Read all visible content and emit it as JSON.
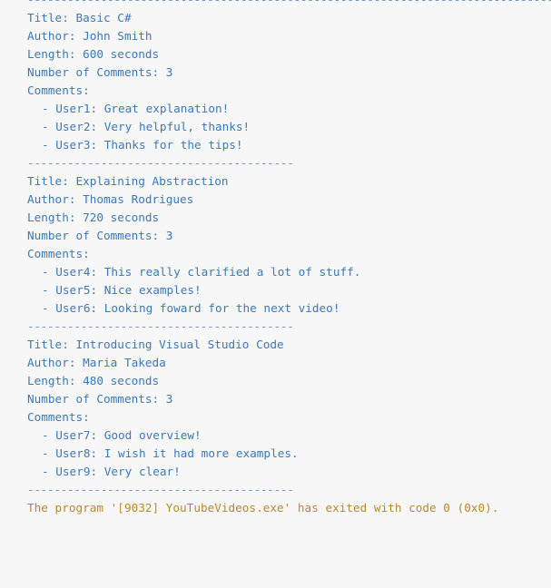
{
  "output": {
    "top_separator": "--------------------------------------------------------------------------------------",
    "videos": [
      {
        "title_line": "Title: Basic C#",
        "author_line": "Author: John Smith",
        "length_line": "Length: 600 seconds",
        "count_line": "Number of Comments: 3",
        "comments_header": "Comments:",
        "comments": [
          "- User1: Great explanation!",
          "- User2: Very helpful, thanks!",
          "- User3: Thanks for the tips!"
        ],
        "separator": "----------------------------------------"
      },
      {
        "title_line": "Title: Explaining Abstraction",
        "author_line": "Author: Thomas Rodrigues",
        "length_line": "Length: 720 seconds",
        "count_line": "Number of Comments: 3",
        "comments_header": "Comments:",
        "comments": [
          "- User4: This really clarified a lot of stuff.",
          "- User5: Nice examples!",
          "- User6: Looking foward for the next video!"
        ],
        "separator": "----------------------------------------"
      },
      {
        "title_line": "Title: Introducing Visual Studio Code",
        "author_line": "Author: Maria Takeda",
        "length_line": "Length: 480 seconds",
        "count_line": "Number of Comments: 3",
        "comments_header": "Comments:",
        "comments": [
          "- User7: Good overview!",
          "- User8: I wish it had more examples.",
          "- User9: Very clear!"
        ],
        "separator": "----------------------------------------"
      }
    ],
    "exit_message": "The program '[9032] YouTubeVideos.exe' has exited with code 0 (0x0)."
  },
  "colors": {
    "text": "#3a78b8",
    "separator": "#6c97c4",
    "exit": "#b5892a",
    "background": "#f7f7f7"
  }
}
